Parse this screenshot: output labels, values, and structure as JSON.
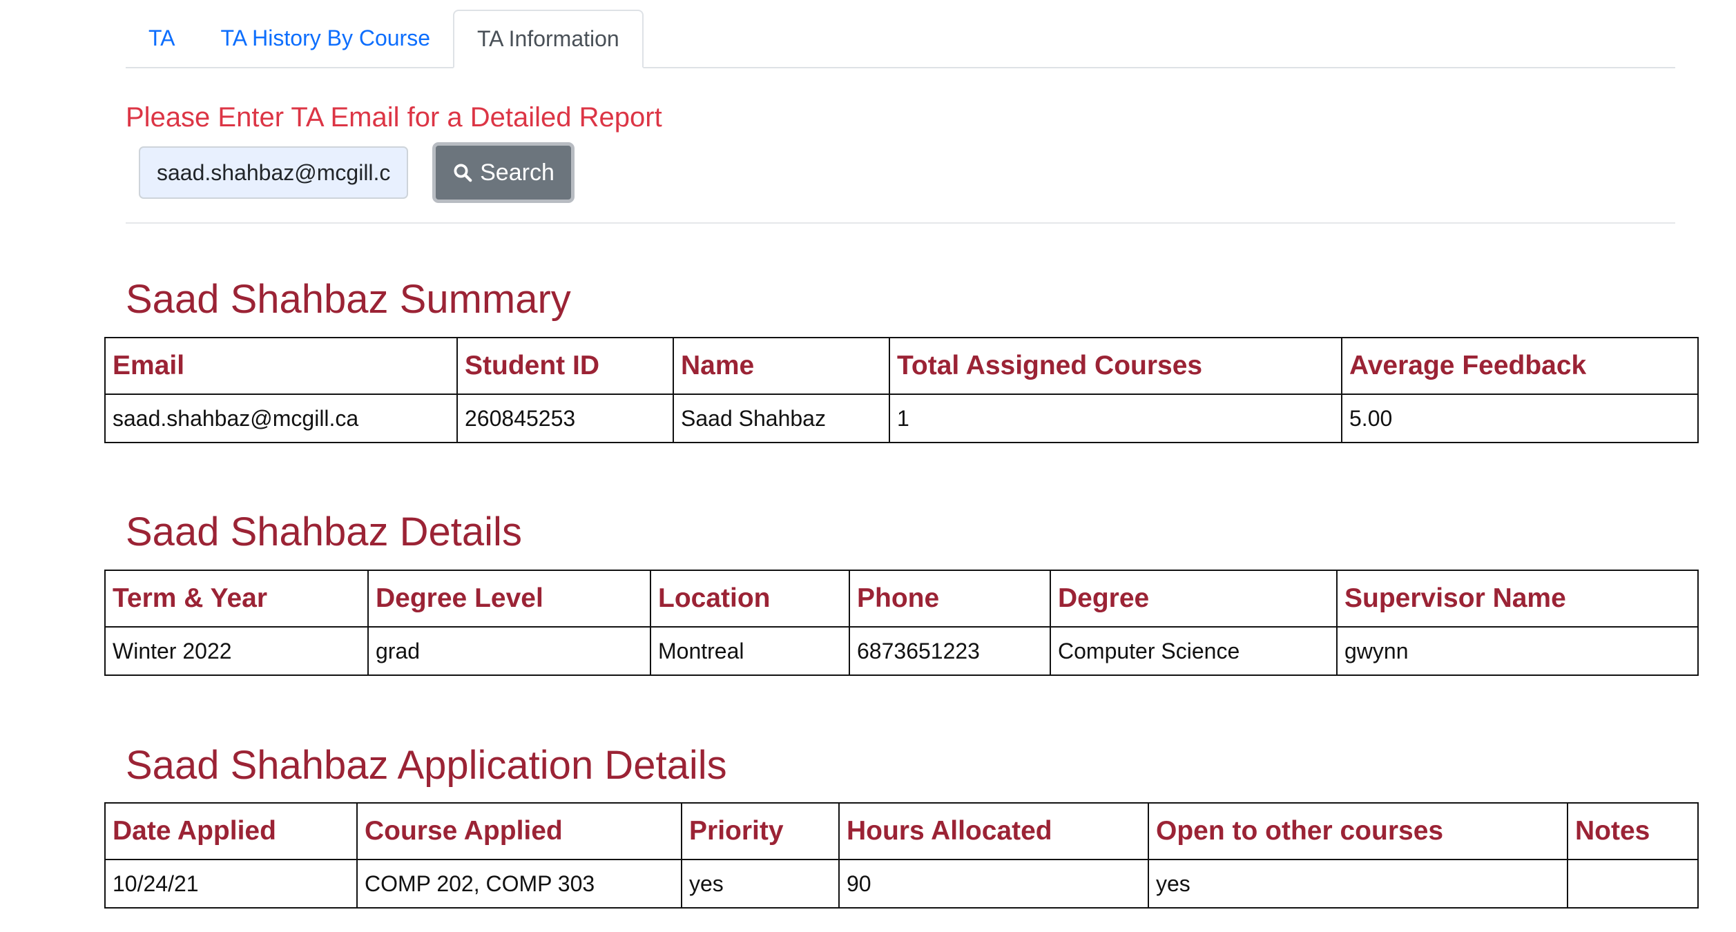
{
  "tabs": [
    {
      "label": "TA",
      "active": false
    },
    {
      "label": "TA History By Course",
      "active": false
    },
    {
      "label": "TA Information",
      "active": true
    }
  ],
  "search": {
    "prompt": "Please Enter TA Email for a Detailed Report",
    "value": "saad.shahbaz@mcgill.ca",
    "button_label": "Search",
    "button_icon": "search-icon"
  },
  "summary": {
    "title": "Saad Shahbaz Summary",
    "headers": [
      "Email",
      "Student ID",
      "Name",
      "Total Assigned Courses",
      "Average Feedback"
    ],
    "row": [
      "saad.shahbaz@mcgill.ca",
      "260845253",
      "Saad Shahbaz",
      "1",
      "5.00"
    ]
  },
  "details": {
    "title": "Saad Shahbaz Details",
    "headers": [
      "Term & Year",
      "Degree Level",
      "Location",
      "Phone",
      "Degree",
      "Supervisor Name"
    ],
    "row": [
      "Winter 2022",
      "grad",
      "Montreal",
      "6873651223",
      "Computer Science",
      "gwynn"
    ]
  },
  "application": {
    "title": "Saad Shahbaz Application Details",
    "headers": [
      "Date Applied",
      "Course Applied",
      "Priority",
      "Hours Allocated",
      "Open to other courses",
      "Notes"
    ],
    "row": [
      "10/24/21",
      "COMP 202, COMP 303",
      "yes",
      "90",
      "yes",
      ""
    ]
  },
  "colors": {
    "tab_link": "#0d6efd",
    "prompt_red": "#dc3545",
    "heading_maroon": "#9b2335",
    "button_gray": "#6c757d",
    "input_bg": "#e8f0fe"
  }
}
